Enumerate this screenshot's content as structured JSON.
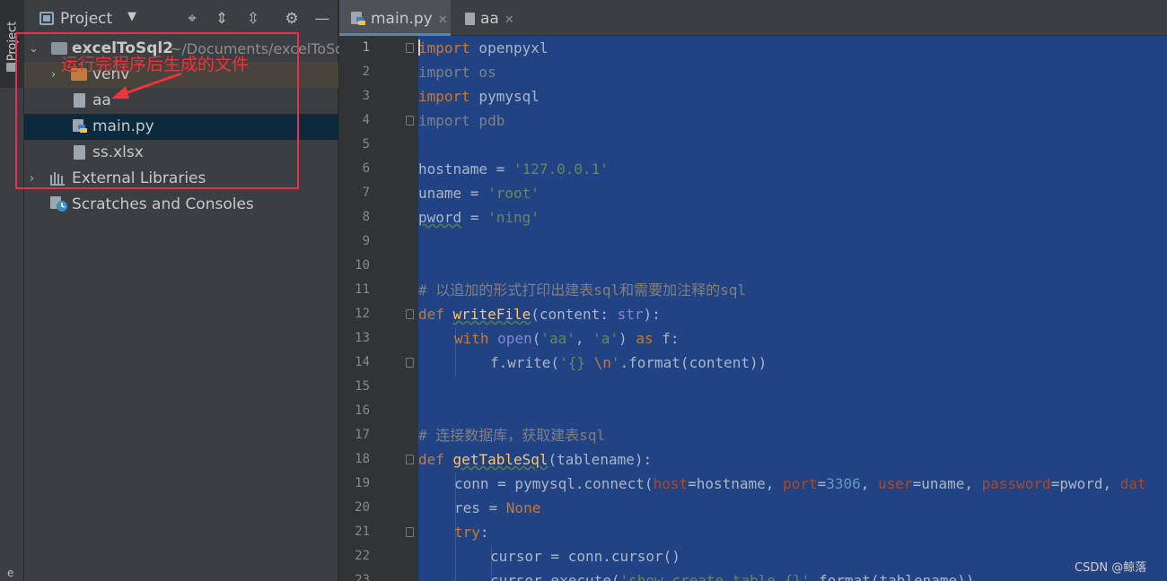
{
  "toolstrip": {
    "project_tab": "Project",
    "bottom_letter": "e"
  },
  "panel": {
    "title": "Project",
    "header_icons": [
      "locate-icon",
      "expand-all-icon",
      "collapse-all-icon",
      "gear-icon",
      "minimize-icon"
    ],
    "tree": {
      "root": {
        "name": "excelToSql2",
        "path": "~/Documents/excelToSq"
      },
      "venv": "venv",
      "aa": "aa",
      "main": "main.py",
      "xlsx": "ss.xlsx",
      "libs": "External Libraries",
      "scratches": "Scratches and Consoles"
    },
    "annotation": "运行完程序后生成的文件"
  },
  "tabs": [
    {
      "label": "main.py",
      "active": true
    },
    {
      "label": "aa",
      "active": false
    }
  ],
  "code": {
    "line_numbers": [
      "1",
      "2",
      "3",
      "4",
      "5",
      "6",
      "7",
      "8",
      "9",
      "10",
      "11",
      "12",
      "13",
      "14",
      "15",
      "16",
      "17",
      "18",
      "19",
      "20",
      "21",
      "22",
      "23"
    ],
    "l1_kw": "import",
    "l1_mod": " openpyxl",
    "l2": "import os",
    "l3_kw": "import",
    "l3_mod": " pymysql",
    "l4": "import pdb",
    "l6_var": "hostname",
    "l6_eq": " = ",
    "l6_str": "'127.0.0.1'",
    "l7_var": "uname",
    "l7_eq": " = ",
    "l7_str": "'root'",
    "l8_var": "pword",
    "l8_eq": " = ",
    "l8_str": "'ning'",
    "l11": "# 以追加的形式打印出建表sql和需要加注释的sql",
    "l12_def": "def",
    "l12_fn": "writeFile",
    "l12_open": "(content: ",
    "l12_type": "str",
    "l12_close": "):",
    "l13_with": "with",
    "l13_open": "open",
    "l13_p1": "(",
    "l13_s1": "'aa'",
    "l13_c": ", ",
    "l13_s2": "'a'",
    "l13_p2": ") ",
    "l13_as": "as",
    "l13_f": " f:",
    "l14_a": "f.write(",
    "l14_s": "'{} ",
    "l14_esc": "\\n",
    "l14_s2": "'",
    "l14_b": ".format(content))",
    "l17": "# 连接数据库，获取建表sql",
    "l18_def": "def",
    "l18_fn": "getTableSql",
    "l18_args": "(tablename):",
    "l19_a": "conn = pymysql.connect(",
    "l19_k1": "host",
    "l19_v1": "=hostname, ",
    "l19_k2": "port",
    "l19_v2a": "=",
    "l19_v2": "3306",
    "l19_v2b": ", ",
    "l19_k3": "user",
    "l19_v3": "=uname, ",
    "l19_k4": "password",
    "l19_v4": "=pword, ",
    "l19_k5": "dat",
    "l20_a": "res = ",
    "l20_none": "None",
    "l21_try": "try",
    "l21_colon": ":",
    "l22": "cursor = conn.cursor()",
    "l23_a": "cursor.execute(",
    "l23_s": "'show create table {}'",
    "l23_b": ".format(tablename))"
  },
  "watermark": "CSDN @鲸落"
}
